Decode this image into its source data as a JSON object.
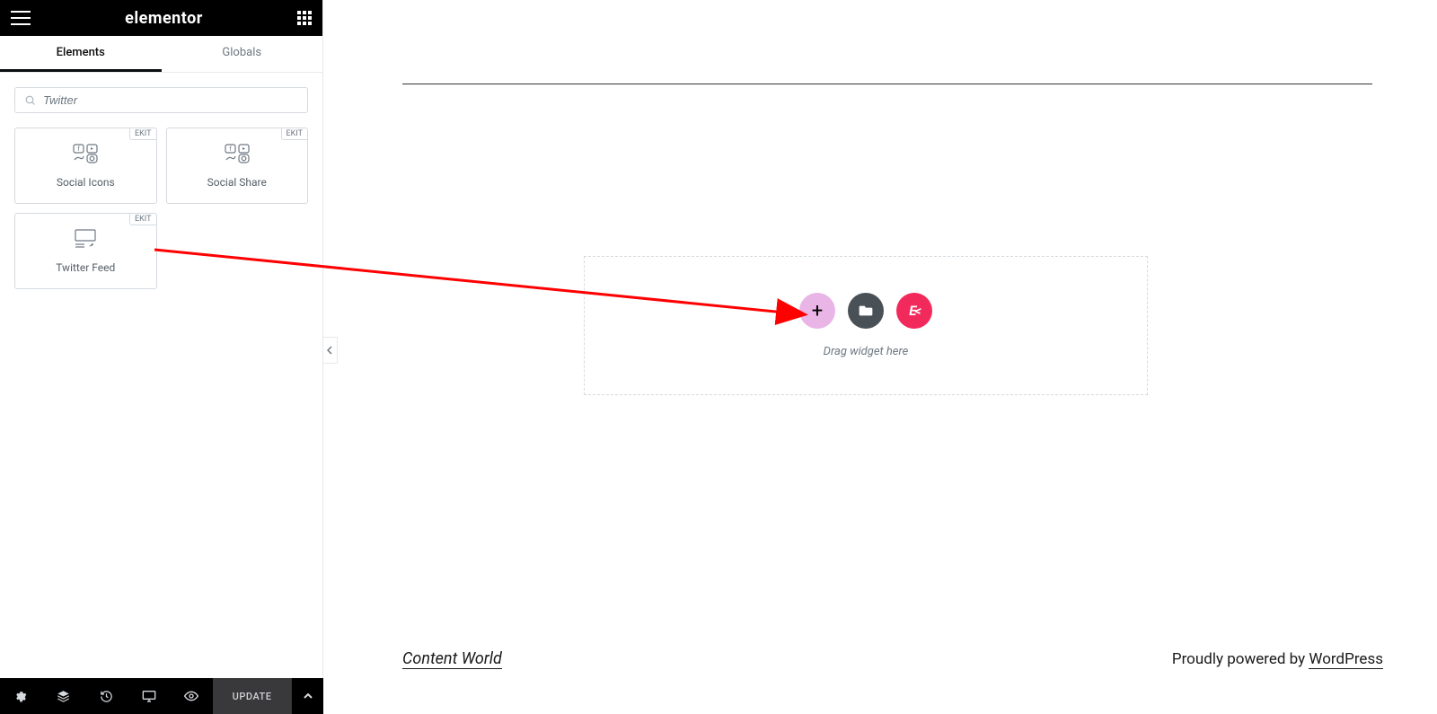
{
  "header": {
    "brand": "elementor"
  },
  "tabs": {
    "elements": "Elements",
    "globals": "Globals"
  },
  "search": {
    "value": "Twitter"
  },
  "widgets": [
    {
      "label": "Social Icons",
      "badge": "EKIT"
    },
    {
      "label": "Social Share",
      "badge": "EKIT"
    },
    {
      "label": "Twitter Feed",
      "badge": "EKIT"
    }
  ],
  "footer": {
    "update": "UPDATE"
  },
  "dropzone": {
    "hint": "Drag widget here",
    "ek_label": "EK"
  },
  "page_footer": {
    "left": "Content World",
    "right_prefix": "Proudly powered by ",
    "right_link": "WordPress"
  }
}
